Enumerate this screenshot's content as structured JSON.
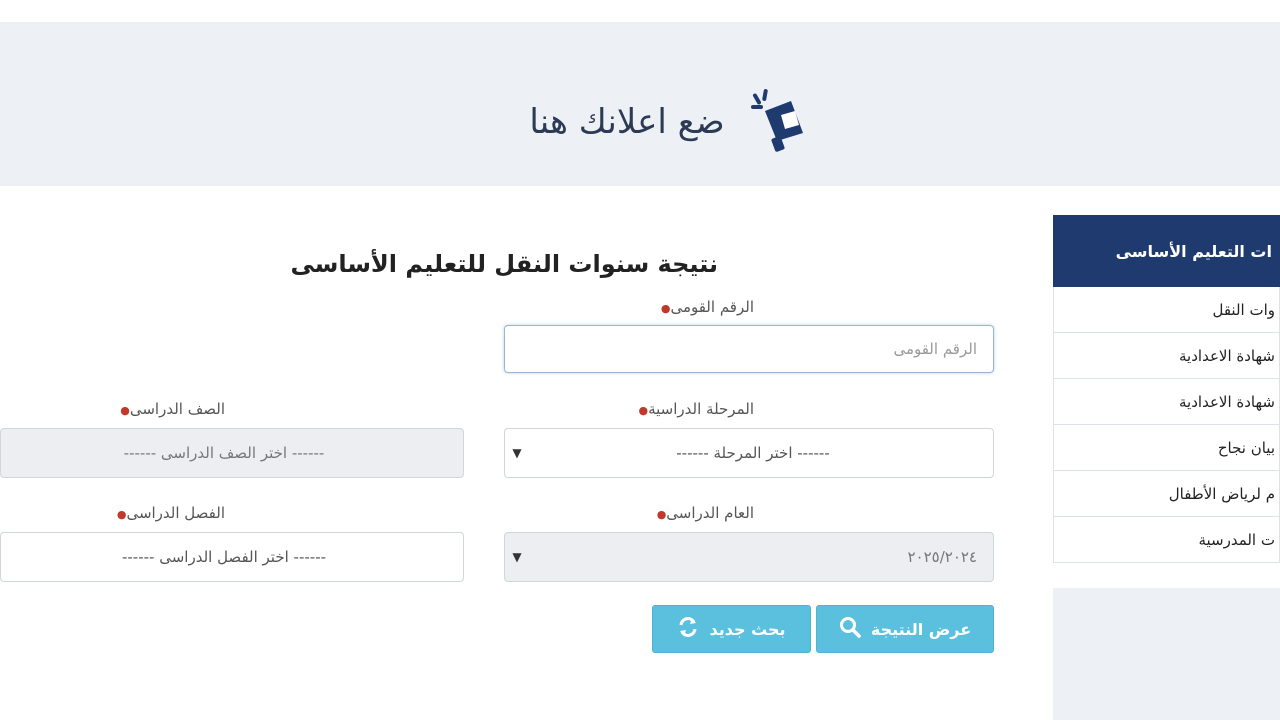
{
  "ad": {
    "text": "ضع اعلانك هنا",
    "icon": "megaphone-icon"
  },
  "form": {
    "title": "نتيجة سنوات النقل للتعليم الأساسى",
    "national_id": {
      "label": "الرقم القومى",
      "placeholder": "الرقم القومى"
    },
    "stage": {
      "label": "المرحلة الدراسية",
      "value": "------ اختر المرحلة ------"
    },
    "grade": {
      "label": "الصف الدراسى",
      "value": "------ اختر الصف الدراسى ------"
    },
    "year": {
      "label": "العام الدراسى",
      "value": "٢٠٢٥/٢٠٢٤"
    },
    "term": {
      "label": "الفصل الدراسى",
      "value": "------ اختر الفصل الدراسى ------"
    },
    "buttons": {
      "show_result": "عرض النتيجة",
      "new_search": "بحث جديد"
    }
  },
  "sidebar": {
    "header": "ات التعليم الأساسى",
    "items": [
      {
        "label": "وات النقل"
      },
      {
        "label": "شهادة الاعدادية"
      },
      {
        "label": "شهادة الاعدادية"
      },
      {
        "label": "بيان نجاح"
      },
      {
        "label": "م لرياض الأطفال"
      },
      {
        "label": "ت المدرسية"
      }
    ]
  },
  "colors": {
    "primary": "#1f3a6e",
    "button": "#5bc0de",
    "banner_bg": "#edf0f5",
    "required": "#c0392b"
  }
}
